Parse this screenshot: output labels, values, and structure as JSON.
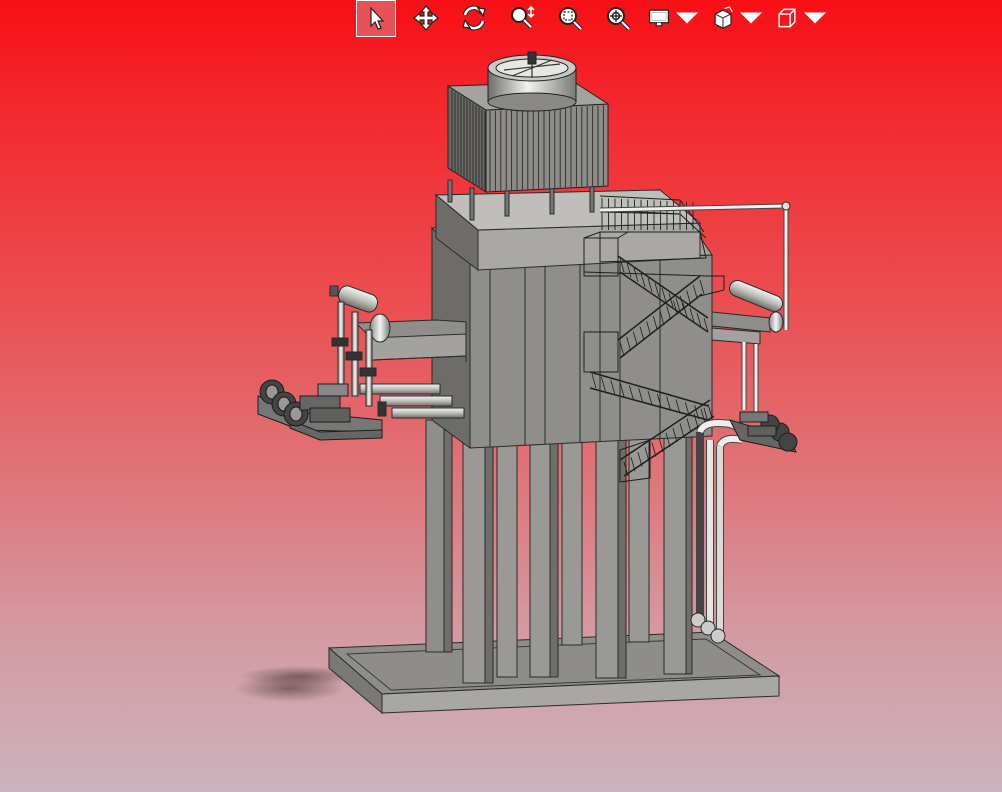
{
  "app": {
    "view": "cooling-tower-model-viewer"
  },
  "toolbar": {
    "active_tool": "select",
    "buttons": [
      {
        "id": "select",
        "icon": "select-arrow-icon",
        "active": true
      },
      {
        "id": "pan",
        "icon": "pan-move-icon",
        "active": false
      },
      {
        "id": "rotate",
        "icon": "rotate-icon",
        "active": false
      },
      {
        "id": "zoom",
        "icon": "zoom-icon",
        "active": false
      },
      {
        "id": "zoom-area",
        "icon": "zoom-area-icon",
        "active": false
      },
      {
        "id": "zoom-fit",
        "icon": "zoom-fit-icon",
        "active": false
      },
      {
        "id": "display",
        "icon": "display-monitor-icon",
        "active": false,
        "dropdown": true
      },
      {
        "id": "section",
        "icon": "section-cube-icon",
        "active": false,
        "dropdown": true
      },
      {
        "id": "view-orientation",
        "icon": "view-cube-icon",
        "active": false,
        "dropdown": true
      }
    ]
  },
  "colors": {
    "background_top": "#f70f15",
    "background_bottom": "#cbb3bd",
    "model_gray": "#8b8a86",
    "active_button": "#e85155"
  }
}
